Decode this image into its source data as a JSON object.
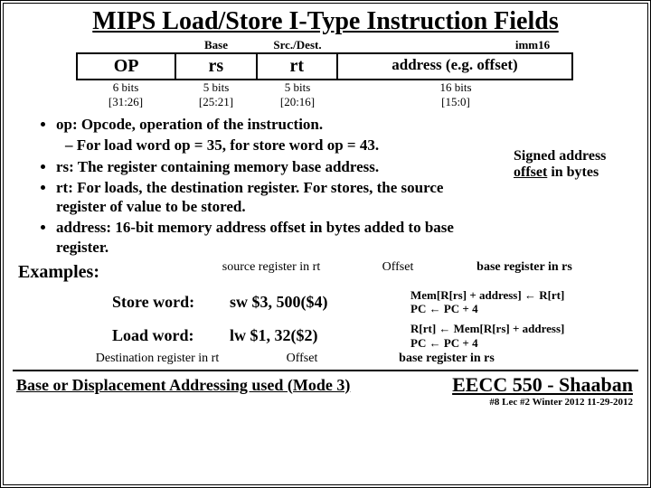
{
  "title": "MIPS Load/Store I-Type Instruction Fields",
  "top_labels": {
    "base": "Base",
    "srcdest": "Src./Dest.",
    "imm": "imm16"
  },
  "fields": {
    "op": {
      "name": "OP",
      "bits": "6 bits",
      "range": "[31:26]"
    },
    "rs": {
      "name": "rs",
      "bits": "5 bits",
      "range": "[25:21]"
    },
    "rt": {
      "name": "rt",
      "bits": "5 bits",
      "range": "[20:16]"
    },
    "address": {
      "name_html": "address (e.g. offset)",
      "bits": "16 bits",
      "range": "[15:0]"
    }
  },
  "offset_note_1": "Signed address",
  "offset_note_2": "offset",
  "offset_note_3": " in bytes",
  "bullets": {
    "b1": "op: Opcode, operation of the instruction.",
    "b1a": "– For load word op = 35, for store word op = 43.",
    "b2": "rs: The register containing memory base address.",
    "b3": "rt: For loads, the destination register. For stores, the source register of value to be stored.",
    "b4": "address: 16-bit memory address offset in bytes added to base register."
  },
  "examples_label": "Examples:",
  "ex_labels": {
    "srcreg": "source register in rt",
    "offset": "Offset",
    "basereg": "base register in rs",
    "destreg": "Destination register in rt"
  },
  "store": {
    "label": "Store word:",
    "instr": "sw $3, 500($4)",
    "mem1": "Mem[R[rs] + address] ← R[rt]",
    "mem2": "PC ← PC + 4"
  },
  "load": {
    "label": "Load word:",
    "instr": "lw $1, 32($2)",
    "mem1": "R[rt] ← Mem[R[rs] + address]",
    "mem2": "PC ← PC + 4"
  },
  "addr_mode": "Base or Displacement Addressing used (Mode 3)",
  "course": "EECC 550 - Shaaban",
  "meta": "#8 Lec #2 Winter 2012 11-29-2012"
}
